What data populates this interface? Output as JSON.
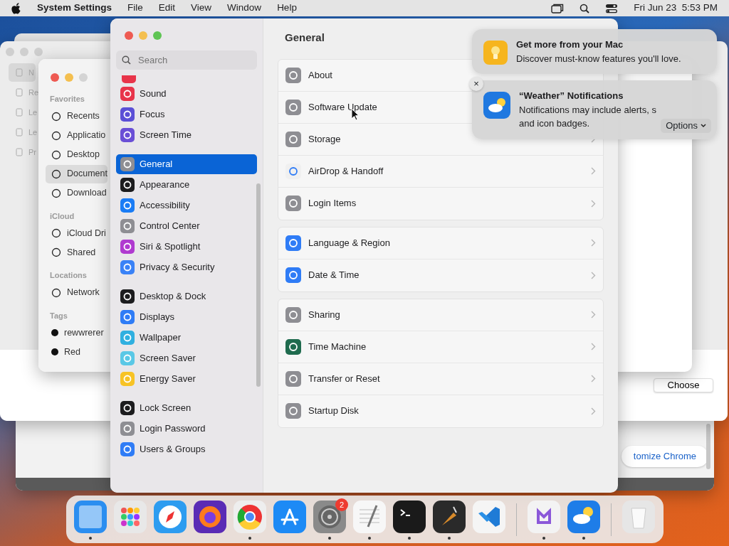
{
  "menu_bar": {
    "app": "System Settings",
    "menus": [
      "File",
      "Edit",
      "View",
      "Window",
      "Help"
    ],
    "clock": "Fri Jun 23  5:53 PM"
  },
  "back_window": {
    "sidebar": [
      {
        "label": "N",
        "selected": true
      },
      {
        "label": "Re",
        "selected": false
      },
      {
        "label": "Le",
        "selected": false
      },
      {
        "label": "Le",
        "selected": false
      },
      {
        "label": "Pr",
        "selected": false
      }
    ],
    "button": "Choose"
  },
  "finder": {
    "sections": [
      {
        "title": "Favorites",
        "items": [
          {
            "label": "Recents",
            "selected": false
          },
          {
            "label": "Applicatio",
            "selected": false
          },
          {
            "label": "Desktop",
            "selected": false
          },
          {
            "label": "Document",
            "selected": true
          },
          {
            "label": "Download",
            "selected": false
          }
        ]
      },
      {
        "title": "iCloud",
        "items": [
          {
            "label": "iCloud Dri",
            "selected": false
          },
          {
            "label": "Shared",
            "selected": false
          }
        ]
      },
      {
        "title": "Locations",
        "items": [
          {
            "label": "Network",
            "selected": false
          }
        ]
      },
      {
        "title": "Tags",
        "items": [
          {
            "label": "rewwrerer",
            "selected": false
          },
          {
            "label": "Red",
            "selected": false
          }
        ]
      }
    ]
  },
  "chrome": {
    "button": "tomize Chrome"
  },
  "settings": {
    "search": {
      "placeholder": "Search"
    },
    "sidebar": [
      [
        {
          "label": "Sound",
          "selected": false
        },
        {
          "label": "Focus",
          "selected": false
        },
        {
          "label": "Screen Time",
          "selected": false
        }
      ],
      [
        {
          "label": "General",
          "selected": true
        },
        {
          "label": "Appearance",
          "selected": false
        },
        {
          "label": "Accessibility",
          "selected": false
        },
        {
          "label": "Control Center",
          "selected": false
        },
        {
          "label": "Siri & Spotlight",
          "selected": false
        },
        {
          "label": "Privacy & Security",
          "selected": false
        }
      ],
      [
        {
          "label": "Desktop & Dock",
          "selected": false
        },
        {
          "label": "Displays",
          "selected": false
        },
        {
          "label": "Wallpaper",
          "selected": false
        },
        {
          "label": "Screen Saver",
          "selected": false
        },
        {
          "label": "Energy Saver",
          "selected": false
        }
      ],
      [
        {
          "label": "Lock Screen",
          "selected": false
        },
        {
          "label": "Login Password",
          "selected": false
        },
        {
          "label": "Users & Groups",
          "selected": false
        }
      ]
    ],
    "title": "General",
    "groups": [
      [
        "About",
        "Software Update",
        "Storage",
        "AirDrop & Handoff",
        "Login Items"
      ],
      [
        "Language & Region",
        "Date & Time"
      ],
      [
        "Sharing",
        "Time Machine",
        "Transfer or Reset",
        "Startup Disk"
      ]
    ]
  },
  "notifications": [
    {
      "title": "Get more from your Mac",
      "lines": [
        "Discover must-know features you'll love."
      ]
    },
    {
      "title": "“Weather” Notifications",
      "lines": [
        "Notifications may include alerts, s",
        "and icon badges."
      ],
      "close": "×",
      "options": "Options"
    }
  ],
  "dock": [
    {
      "kind": "app",
      "running": true
    },
    {
      "kind": "app",
      "running": false
    },
    {
      "kind": "app",
      "running": false
    },
    {
      "kind": "app",
      "running": false
    },
    {
      "kind": "app",
      "running": true
    },
    {
      "kind": "app",
      "running": false
    },
    {
      "kind": "app",
      "running": true,
      "badge": "2"
    },
    {
      "kind": "app",
      "running": true
    },
    {
      "kind": "app",
      "running": true
    },
    {
      "kind": "app",
      "running": true
    },
    {
      "kind": "app",
      "running": false
    },
    {
      "kind": "separator"
    },
    {
      "kind": "app",
      "running": true
    },
    {
      "kind": "app",
      "running": true
    },
    {
      "kind": "separator"
    },
    {
      "kind": "app",
      "running": false
    }
  ]
}
